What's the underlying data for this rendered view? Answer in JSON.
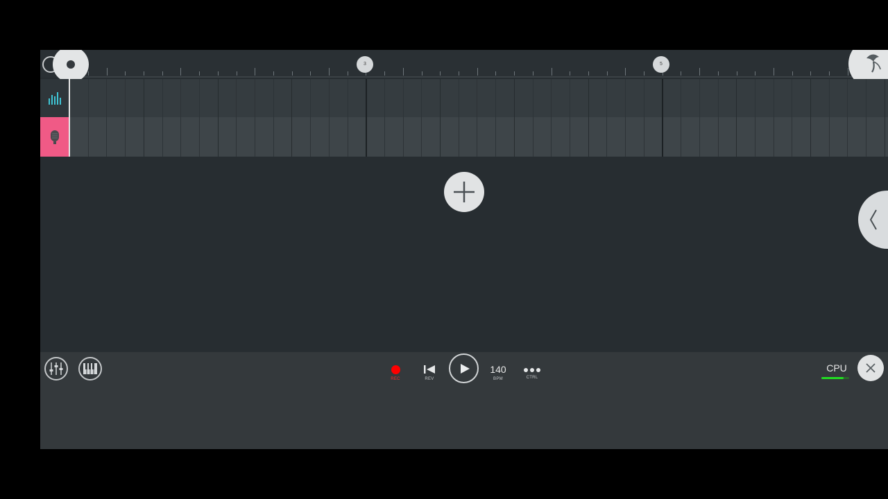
{
  "timeline": {
    "markers": [
      {
        "label": "3",
        "position": 3
      },
      {
        "label": "5",
        "position": 5
      }
    ]
  },
  "tracks": [
    {
      "name": "bars-track",
      "icon": "equalizer-bars-icon",
      "color": "#2f363a"
    },
    {
      "name": "audio-track",
      "icon": "microphone-icon",
      "color": "#f05a86"
    }
  ],
  "toolbar": {
    "rec_label": "REC",
    "rev_label": "REV",
    "bpm_value": "140",
    "bpm_label": "BPM",
    "ctrl_label": "CTRL",
    "cpu_label": "CPU",
    "cpu_level": 0.8
  },
  "colors": {
    "accent_pink": "#f05a86",
    "teal_icon": "#3fc6d6",
    "record_red": "#ff0000",
    "cpu_green": "#22dd22"
  }
}
